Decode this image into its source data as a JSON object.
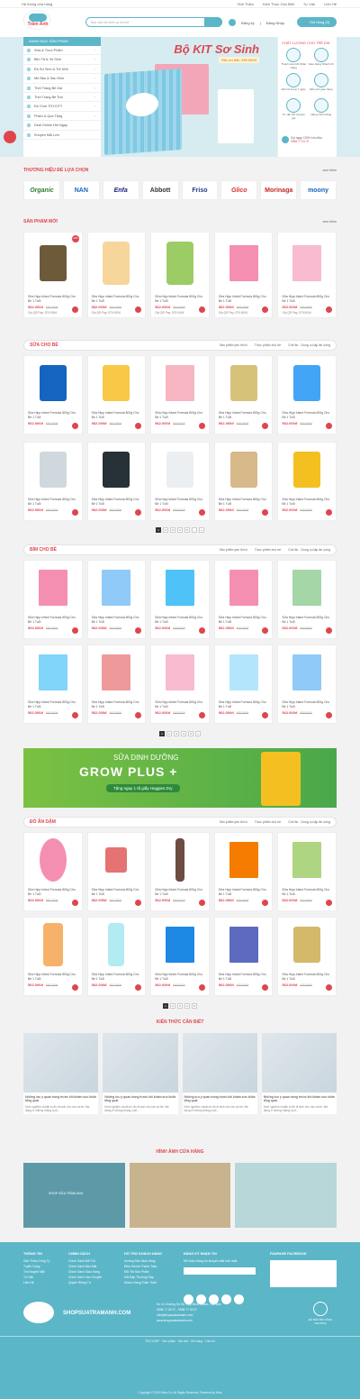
{
  "topbar": {
    "left": "Hệ thống cửa hàng",
    "links": [
      "Giới Thiệu",
      "Kiến Thức Cần Biết",
      "Tư Vấn",
      "Liên Hệ"
    ]
  },
  "header": {
    "logo": "Trâm Anh",
    "search_placeholder": "Bạn cần tìm kiếm gì cho bé",
    "register": "Đăng ký",
    "login": "Đăng Nhập",
    "cart": "Giỏ hàng (0)"
  },
  "catmenu": {
    "title": "DANH MỤC SẢN PHẨM",
    "items": [
      "Sữa & Thực Phẩm",
      "Bỉm Tã & Vệ Sinh",
      "Đồ Sơ Sinh & Trẻ Nhỏ",
      "Mẹ Bầu & Sau Sinh",
      "Thời Trang Bé Gái",
      "Thời Trang Bé Trai",
      "Đồ Chơi TOYCITY",
      "Phiếu & Quà Tặng",
      "Deal Online Hời Ngày",
      "Khuyến Mãi Lớn"
    ]
  },
  "banner": {
    "title": "Bộ KIT Sơ Sinh",
    "sub": "Giá ưu đãi: 399.000đ"
  },
  "quality": {
    "title": "CHẤT LƯỢNG CHO TRẺ EM",
    "items": [
      "Thanh toán khi Nhận Hàng",
      "Giao Hàng Nhanh 2h",
      "Đổi trả trong 7 ngày",
      "Miễn phí giao hàng",
      "Tư vấn bởi chuyên gia",
      "Hàng chính hãng"
    ],
    "hotline": "Gọi ngay CSKH chu đáo",
    "hotline_num": "0938 77 03 37"
  },
  "brands": {
    "title": "THƯƠNG HIỆU ĐỂ LỰA CHỌN",
    "see": "xem thêm",
    "items": [
      "Organic",
      "NAN",
      "Enfa",
      "Abbott",
      "Friso",
      "Glico",
      "Morinaga",
      "moony"
    ]
  },
  "new_products": {
    "title": "SẢN PHẨM MỚI",
    "see": "xem thêm"
  },
  "milk": {
    "title": "SỮA CHO BÉ",
    "tabs": [
      "Sản phẩm yêu thích",
      "Thực phẩm cho bé",
      "Chế ăn - Dung cụ tập ăn uống"
    ]
  },
  "diaper": {
    "title": "BỈM CHO BÉ",
    "tabs": [
      "Sản phẩm yêu thích",
      "Thực phẩm cho bé",
      "Chế ăn - Dung cụ tập ăn uống"
    ]
  },
  "weaning": {
    "title": "ĐỒ ĂN DẶM",
    "tabs": [
      "Sản phẩm yêu thích",
      "Thực phẩm cho bé",
      "Chế ăn - Dung cụ tập ăn uống"
    ]
  },
  "product": {
    "name": "Sữa Hipp Infant Formula 800g Cho Bé 1 Tuổi",
    "price": "562.000đ",
    "old": "600.000đ",
    "qr": "Giá QR Pay: 579.900đ"
  },
  "pagination": [
    "1",
    "2",
    "3",
    "4",
    "5",
    "...",
    "»"
  ],
  "promo": {
    "line1": "SỮA DINH DƯỠNG",
    "line2": "GROW PLUS +",
    "line3": "Tặng ngay 1 tã giấy Huggies Dry"
  },
  "news": {
    "title": "KIẾN THỨC CẦN BIẾT",
    "headline": "Những lưu ý quan trọng trước khi khám sức khỏe tổng quát",
    "desc": "Kinh nghiệm chuẩn bị đồ đi sinh cho mẹ và bé: Mẹ đang ở những tháng cuối..."
  },
  "store": {
    "title": "HÌNH ẢNH CỬA HÀNG",
    "overlay": "SHOP SỮA TRÂM ANH"
  },
  "footer": {
    "col1": {
      "title": "THÔNG TIN",
      "items": [
        "Giới Thiệu Công Ty",
        "Tuyển Dụng",
        "Tin Khuyến Mãi",
        "Tư Vấn",
        "Liên Hệ"
      ]
    },
    "col2": {
      "title": "CHÍNH SÁCH",
      "items": [
        "Chính Sách Đổi Trả",
        "Chính Sách Bảo Mật",
        "Chính Sách Giao Hàng",
        "Chính Sách Vận Chuyển",
        "Quyền Riêng Tư"
      ]
    },
    "col3": {
      "title": "HỖ TRỢ KHÁCH HÀNG",
      "items": [
        "Hướng Dẫn Mua Hàng",
        "Điều Khoản Thanh Toán",
        "Đổi Trả Sản Phẩm",
        "Hỏi Đáp Thường Gặp",
        "Khách Hàng Thân Thiết"
      ]
    },
    "col4": {
      "title": "ĐĂNG KÝ NHẬN TIN",
      "text": "Để nhận thông tin khuyến mãi mới nhất"
    },
    "col5": {
      "title": "FANPAGE FACEBOOK"
    },
    "site": "SHOPSUATRAMANH.COM",
    "addr": [
      "Số 10, Đường Số 26, Hiệp Bình Chánh, Thủ Đức",
      "0938 77 03 37 - 0938 77 03 37",
      "info@shopsuatramanh.com",
      "www.shopsuatramanh.com"
    ],
    "seal": "ĐÃ BÁO BỘ CÔNG THƯƠNG",
    "nav": "TRỢ GIÚP  ·  Sản phẩm  ·  Bài viết  ·  Giỏ hàng  ·  Liên hệ",
    "copy": "Copyright © 2020 Nina Co. All Rights Reserved. Powered by Nina"
  },
  "colors": {
    "accent": "#5bb6c8",
    "red": "#e0454e"
  }
}
